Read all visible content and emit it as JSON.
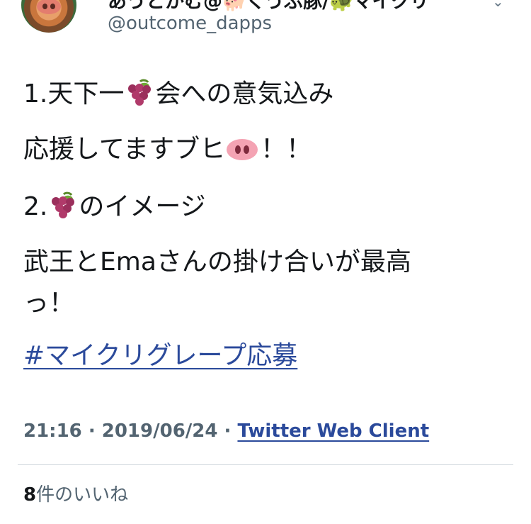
{
  "author": {
    "display_name": "あうとかむ@🐖くうぶ豚/🐢マイクリ",
    "handle": "@outcome_dapps"
  },
  "tweet": {
    "line1_prefix": "1.天下一",
    "line1_suffix": "会への意気込み",
    "line2_text": "応援してますブヒ",
    "line2_suffix": "！！",
    "line3_prefix": "2.",
    "line3_suffix": "のイメージ",
    "line4_text": "武王とEmaさんの掛け合いが最高",
    "line5_text": "っ！",
    "hashtag": "#マイクリグレープ応募",
    "grape_emoji": "grape-emoji",
    "pig_emoji": "pig-nose-emoji"
  },
  "meta": {
    "time": "21:16",
    "separator": " · ",
    "date": "2019/06/24",
    "client": "Twitter Web Client"
  },
  "likes": {
    "count": "8",
    "label": "件のいいね"
  },
  "colors": {
    "link": "#2b4a9b",
    "text": "#14171a",
    "muted": "#536471",
    "divider": "#cfd6dc"
  }
}
